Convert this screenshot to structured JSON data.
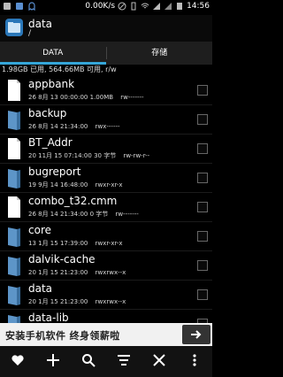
{
  "statusbar": {
    "speed": "0.00K/s",
    "time": "14:56"
  },
  "appbar": {
    "title": "data",
    "path": "/"
  },
  "tabs": [
    {
      "label": "DATA",
      "active": true
    },
    {
      "label": "存储",
      "active": false
    }
  ],
  "storage_info": "1.98GB 已用, 564.66MB 可用, r/w",
  "files": [
    {
      "name": "appbank",
      "date": "26 8月 13 00:00:00",
      "detail": "1.00MB",
      "perm": "rw-------",
      "type": "file"
    },
    {
      "name": "backup",
      "date": "26 8月 14 21:34:00",
      "detail": "",
      "perm": "rwx------",
      "type": "folder"
    },
    {
      "name": "BT_Addr",
      "date": "20 11月 15 07:14:00",
      "detail": "30 字节",
      "perm": "rw-rw-r--",
      "type": "file"
    },
    {
      "name": "bugreport",
      "date": "19 9月 14 16:48:00",
      "detail": "",
      "perm": "rwxr-xr-x",
      "type": "file"
    },
    {
      "name": "combo_t32.cmm",
      "date": "26 8月 14 21:34:00",
      "detail": "0 字节",
      "perm": "rw-------",
      "type": "file"
    },
    {
      "name": "core",
      "date": "13 1月 15 17:39:00",
      "detail": "",
      "perm": "rwxr-xr-x",
      "type": "folder"
    },
    {
      "name": "dalvik-cache",
      "date": "20 1月 15 21:23:00",
      "detail": "",
      "perm": "rwxrwx--x",
      "type": "folder"
    },
    {
      "name": "data",
      "date": "20 1月 15 21:23:00",
      "detail": "",
      "perm": "rwxrwx--x",
      "type": "folder"
    },
    {
      "name": "data-lib",
      "date": "",
      "detail": "",
      "perm": "",
      "type": "folder"
    }
  ],
  "banner": {
    "text": "安装手机软件 终身领薪啦"
  },
  "icons": {
    "favorite": "heart-icon",
    "add": "plus-icon",
    "search": "search-icon",
    "sort": "sort-icon",
    "close": "close-icon",
    "more": "more-icon"
  },
  "colors": {
    "accent": "#35a6d8",
    "folder": "#5d95c8",
    "background": "#000000"
  }
}
